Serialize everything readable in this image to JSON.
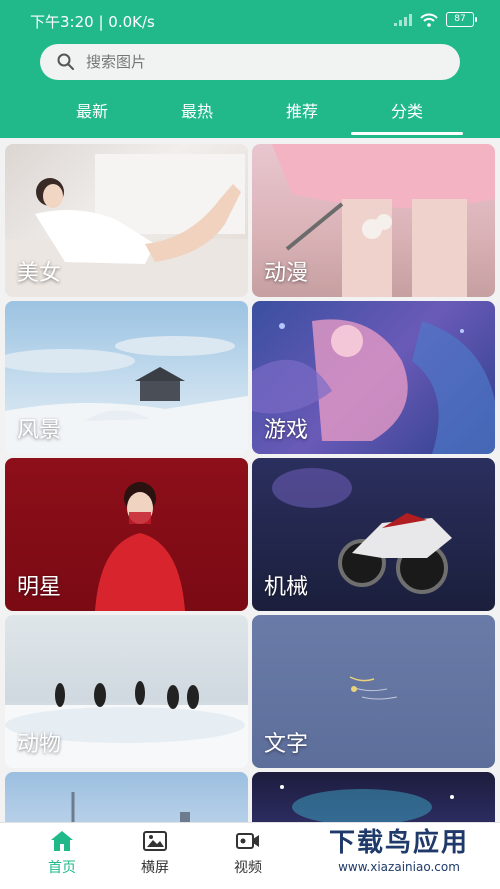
{
  "status_bar": {
    "time": "下午3:20 | 0.0K/s",
    "battery": "87"
  },
  "search": {
    "placeholder": "搜索图片"
  },
  "tabs": [
    {
      "label": "最新"
    },
    {
      "label": "最热"
    },
    {
      "label": "推荐"
    },
    {
      "label": "分类"
    }
  ],
  "categories": [
    {
      "label": "美女"
    },
    {
      "label": "动漫"
    },
    {
      "label": "风景"
    },
    {
      "label": "游戏"
    },
    {
      "label": "明星"
    },
    {
      "label": "机械"
    },
    {
      "label": "动物"
    },
    {
      "label": "文字"
    }
  ],
  "bottom_nav": [
    {
      "label": "首页"
    },
    {
      "label": "横屏"
    },
    {
      "label": "视频"
    }
  ],
  "watermark": {
    "line1": "下载鸟应用",
    "line2": "www.xiazainiao.com"
  },
  "colors": {
    "accent": "#22b98a"
  }
}
